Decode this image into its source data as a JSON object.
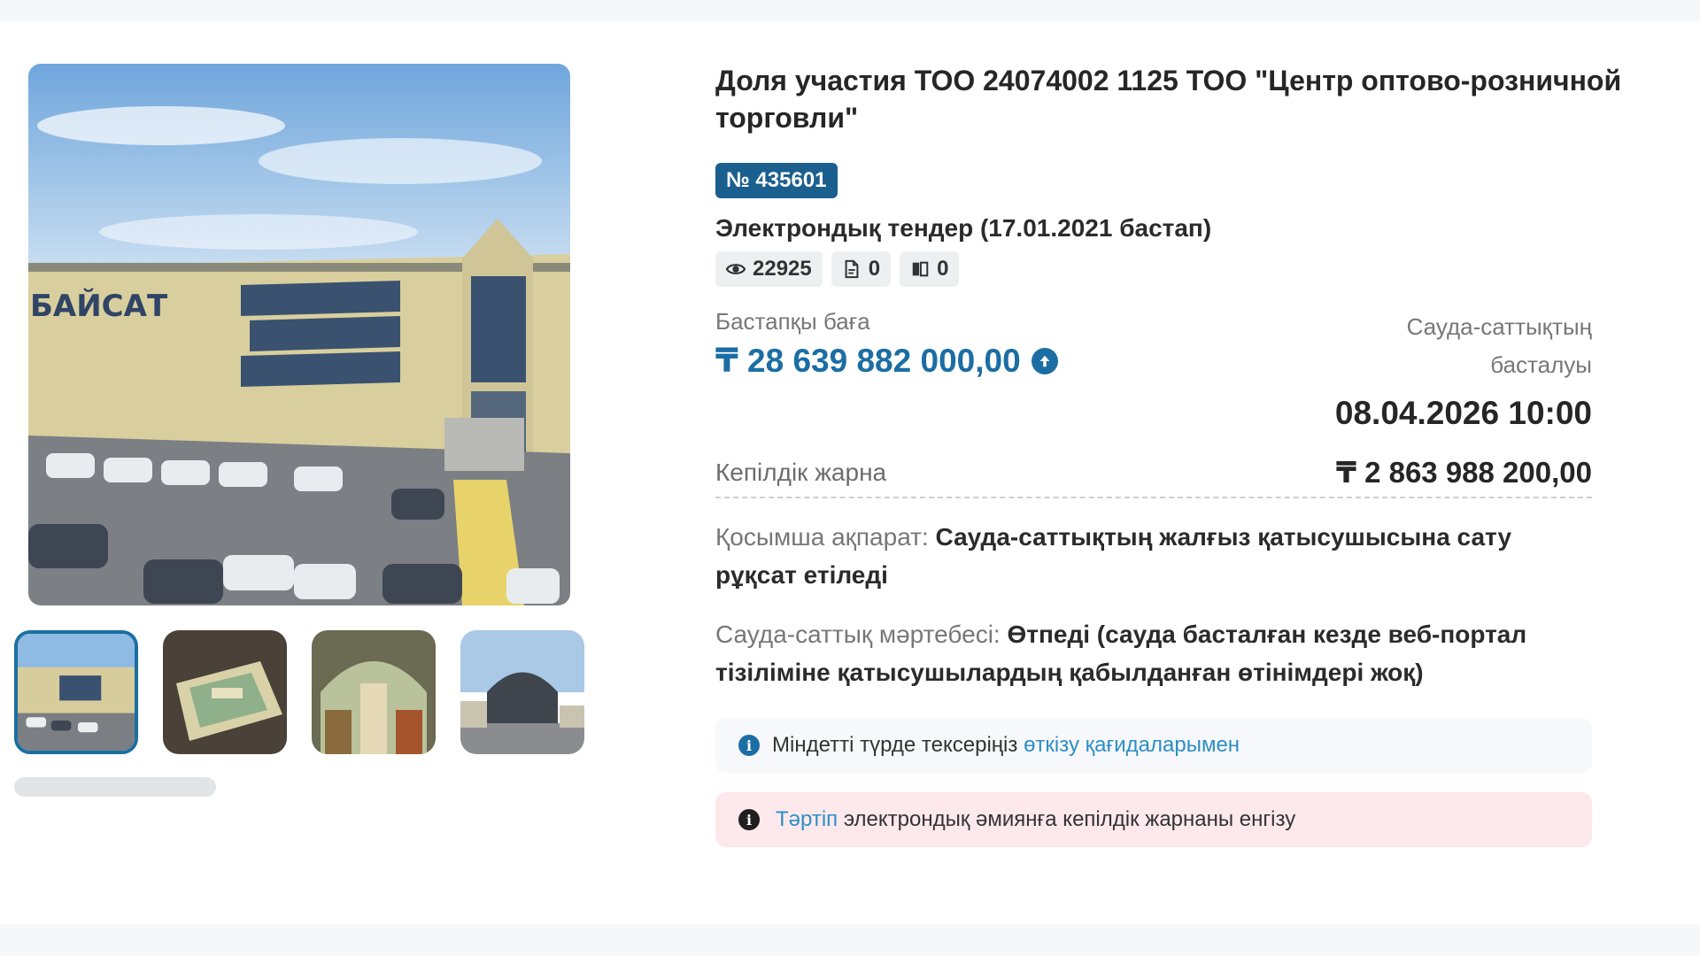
{
  "lot": {
    "title": "Доля участия ТОО 24074002 1125 ТОО \"Центр оптово-розничной торговли\"",
    "number": "№ 435601",
    "tender_type": "Электрондық тендер (17.01.2021 бастап)"
  },
  "stats": {
    "views": "22925",
    "documents": "0",
    "bids": "0"
  },
  "price": {
    "label": "Бастапқы баға",
    "value": "₸ 28 639 882 000,00"
  },
  "auction_start": {
    "label": "Сауда-саттықтың басталуы",
    "value": "08.04.2026 10:00"
  },
  "deposit": {
    "label": "Кепілдік жарна",
    "value": "₸ 2 863 988 200,00"
  },
  "additional_info": {
    "label": "Қосымша ақпарат:",
    "text": "Сауда-саттықтың жалғыз қатысушысына сату рұқсат етіледі"
  },
  "auction_status": {
    "label": "Сауда-саттық мәртебесі:",
    "text": "Өтпеді (сауда басталған кезде веб-портал тізіліміне қатысушылардың қабылданған өтінімдері жоқ)"
  },
  "notices": {
    "info_text": "Міндетті түрде тексеріңіз",
    "info_link": "өткізу қағидаларымен",
    "warn_link": "Тәртіп",
    "warn_text": "электрондық әмиянға кепілдік жарнаны енгізу"
  },
  "gallery": {
    "building_sign": "БАЙСАТ",
    "thumbnail_count": 4,
    "active_thumbnail": 1
  },
  "colors": {
    "accent": "#1b6ea3",
    "badge": "#1b5f8f",
    "warn_bg": "#fde8ec"
  }
}
